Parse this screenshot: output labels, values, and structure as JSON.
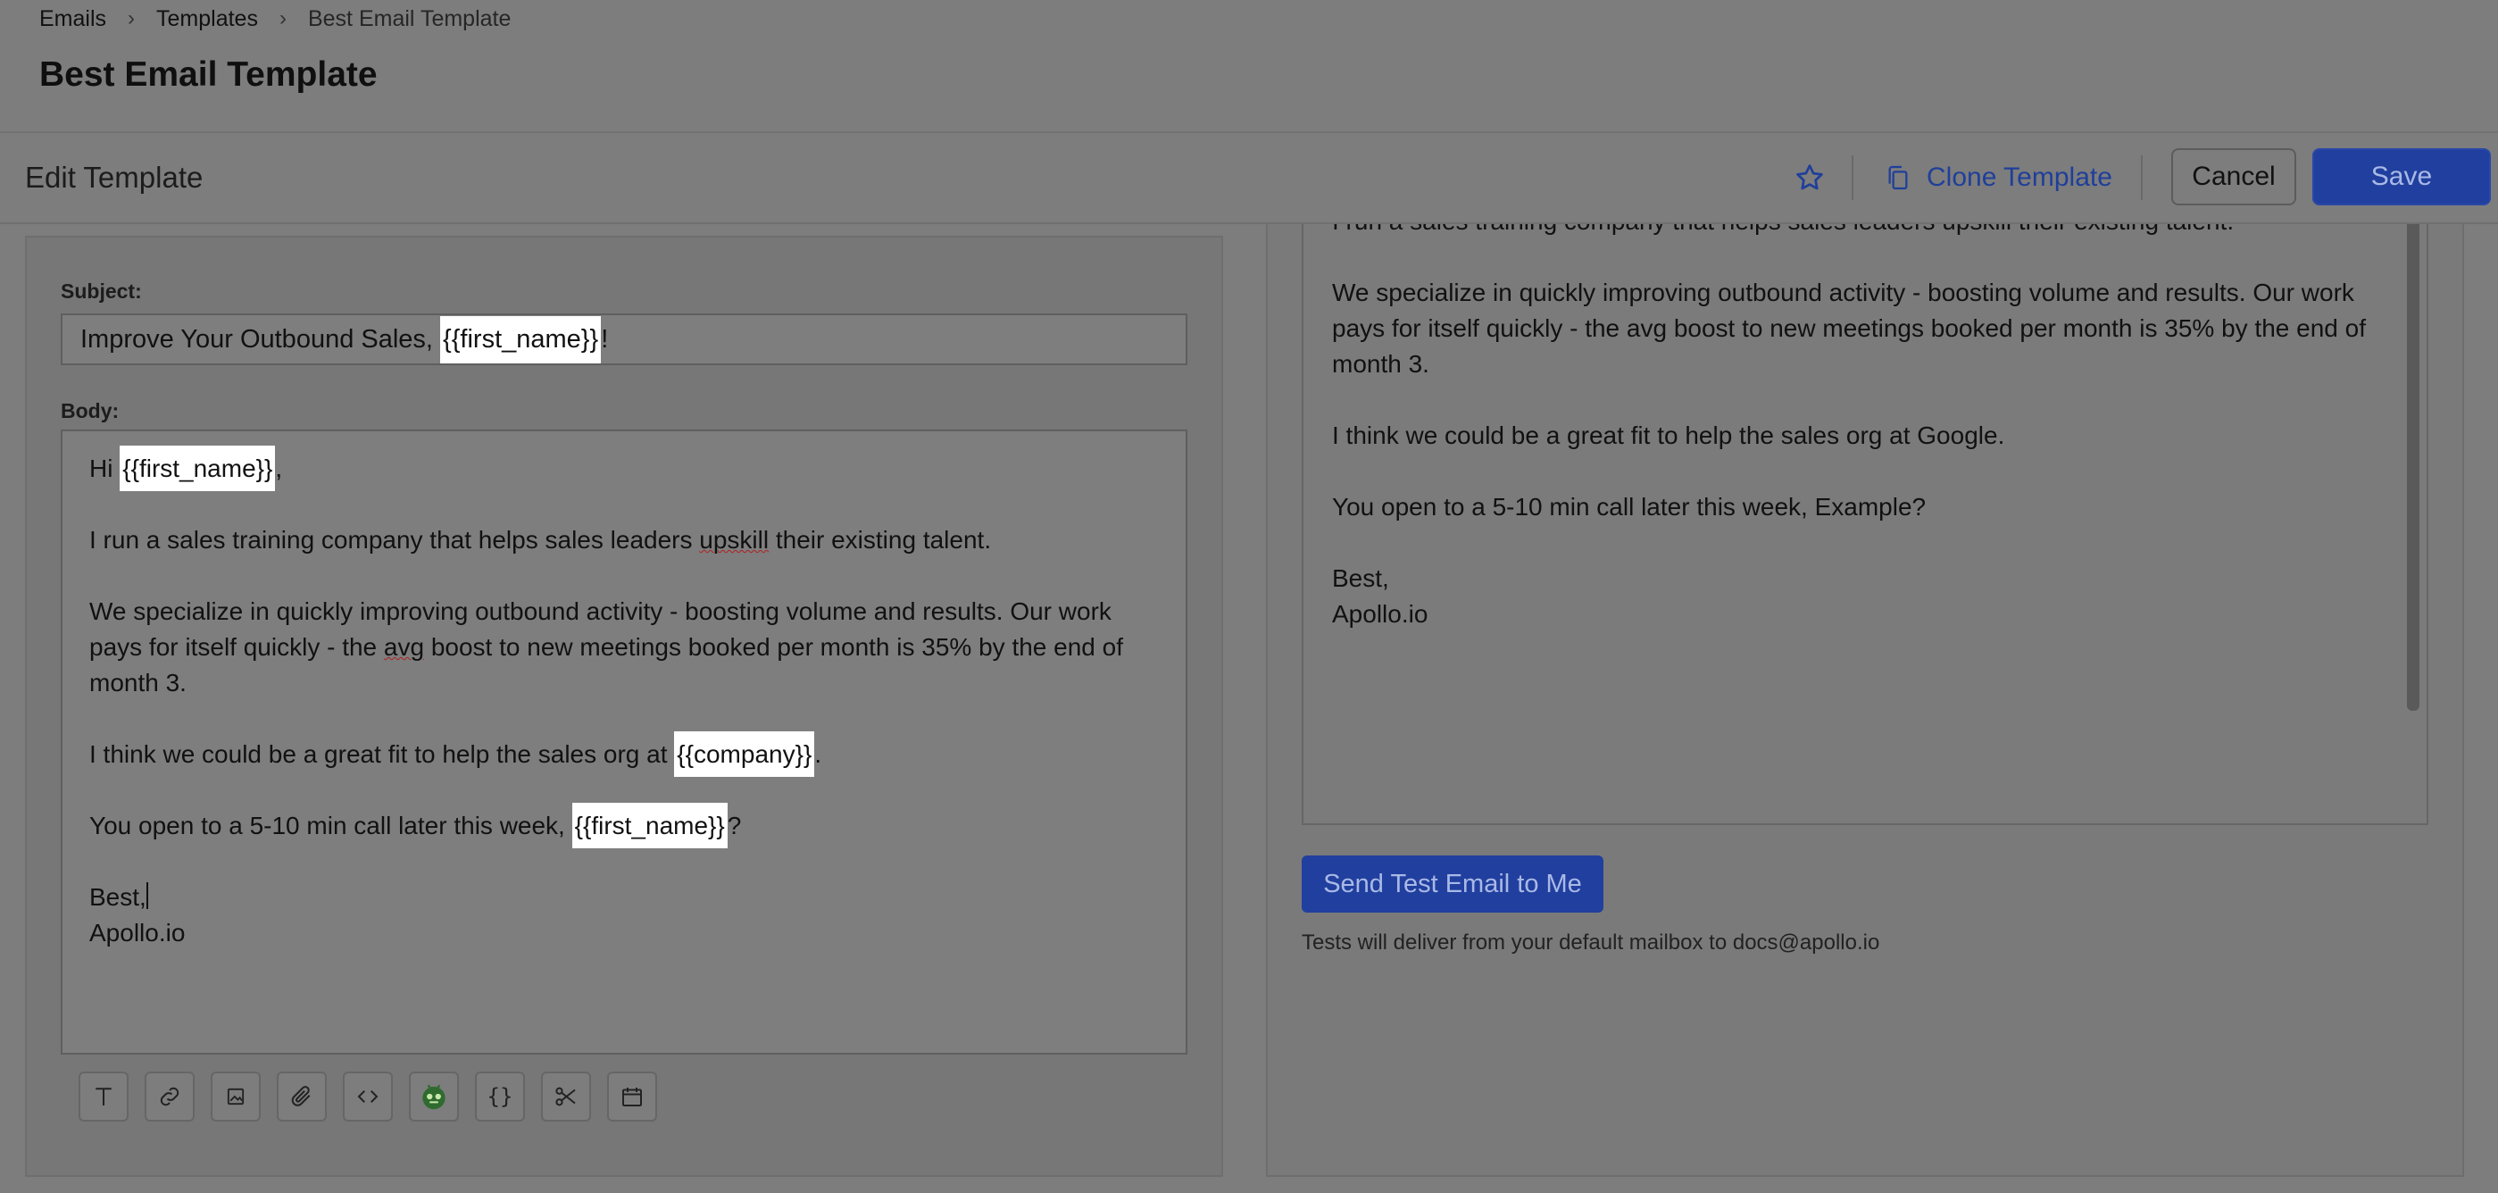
{
  "breadcrumb": [
    "Emails",
    "Templates",
    "Best Email Template"
  ],
  "page_title": "Best Email Template",
  "toolbar": {
    "edit_title": "Edit Template",
    "clone_label": "Clone Template",
    "cancel_label": "Cancel",
    "save_label": "Save"
  },
  "editor": {
    "subject_label": "Subject:",
    "subject_prefix": "Improve Your Outbound Sales, ",
    "subject_var": "{{first_name}}",
    "subject_suffix": "!",
    "body_label": "Body:",
    "greeting_prefix": "Hi ",
    "greeting_var": "{{first_name}}",
    "greeting_suffix": ",",
    "p1_a": "I run a sales training company that helps sales leaders ",
    "p1_squiggle": "upskill",
    "p1_b": " their existing talent.",
    "p2_a": "We specialize in quickly improving outbound activity - boosting volume and results. Our work pays for itself quickly - the ",
    "p2_squiggle": "avg",
    "p2_b": " boost to new meetings booked per month is 35% by the end of month 3.",
    "p3_a": "I think we could be a great fit to help the sales org at ",
    "p3_var": "{{company}}",
    "p3_b": ".",
    "p4_a": "You open to a 5-10 min call later this week, ",
    "p4_var": "{{first_name}}",
    "p4_b": "?",
    "sign_1": "Best,",
    "sign_2": "Apollo.io"
  },
  "editor_tools": [
    "text-format-icon",
    "link-icon",
    "image-icon",
    "attachment-icon",
    "code-icon",
    "ai-assistant-icon",
    "variables-icon",
    "snippet-icon",
    "calendar-icon"
  ],
  "preview": {
    "cut_line": "I run a sales training company that helps sales leaders upskill their existing talent.",
    "p2": "We specialize in quickly improving outbound activity - boosting volume and results. Our work pays for itself quickly - the avg boost to new meetings booked per month is 35% by the end of month 3.",
    "p3": "I think we could be a great fit to help the sales org at Google.",
    "p4": "You open to a 5-10 min call later this week, Example?",
    "sign_1": "Best,",
    "sign_2": "Apollo.io"
  },
  "test_email": {
    "button_label": "Send Test Email to Me",
    "hint": "Tests will deliver from your default mailbox to docs@apollo.io"
  },
  "colors": {
    "accent": "#213f9e",
    "link": "#1f3f9a",
    "overlay_bg": "#7d7d7d"
  }
}
